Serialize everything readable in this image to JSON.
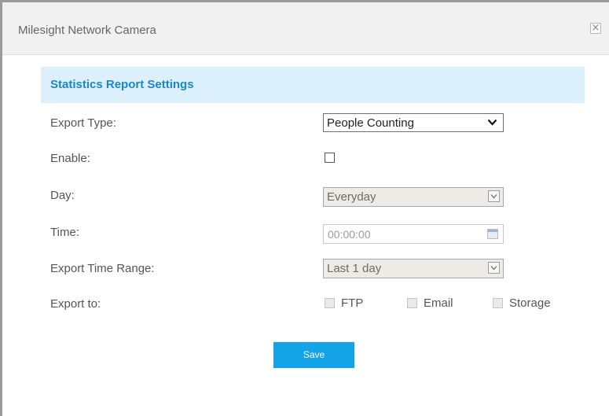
{
  "window": {
    "title": "Milesight Network Camera",
    "close_symbol": "×"
  },
  "section": {
    "title": "Statistics Report Settings"
  },
  "form": {
    "export_type": {
      "label": "Export Type:",
      "value": "People Counting"
    },
    "enable": {
      "label": "Enable:",
      "checked": false
    },
    "day": {
      "label": "Day:",
      "value": "Everyday",
      "disabled": true
    },
    "time": {
      "label": "Time:",
      "value": "00:00:00",
      "disabled": true
    },
    "export_time_range": {
      "label": "Export Time Range:",
      "value": "Last 1 day",
      "disabled": true
    },
    "export_to": {
      "label": "Export to:",
      "options": [
        {
          "label": "FTP",
          "checked": false,
          "disabled": true
        },
        {
          "label": "Email",
          "checked": false,
          "disabled": true
        },
        {
          "label": "Storage",
          "checked": false,
          "disabled": true
        }
      ]
    }
  },
  "buttons": {
    "save_label": "Save"
  },
  "colors": {
    "accent": "#14a3e6",
    "section_bg": "#dbf0fb",
    "section_title": "#1b87c9"
  },
  "icons": {
    "close": "close-icon",
    "dropdown": "chevron-down-icon",
    "calendar": "calendar-icon"
  }
}
